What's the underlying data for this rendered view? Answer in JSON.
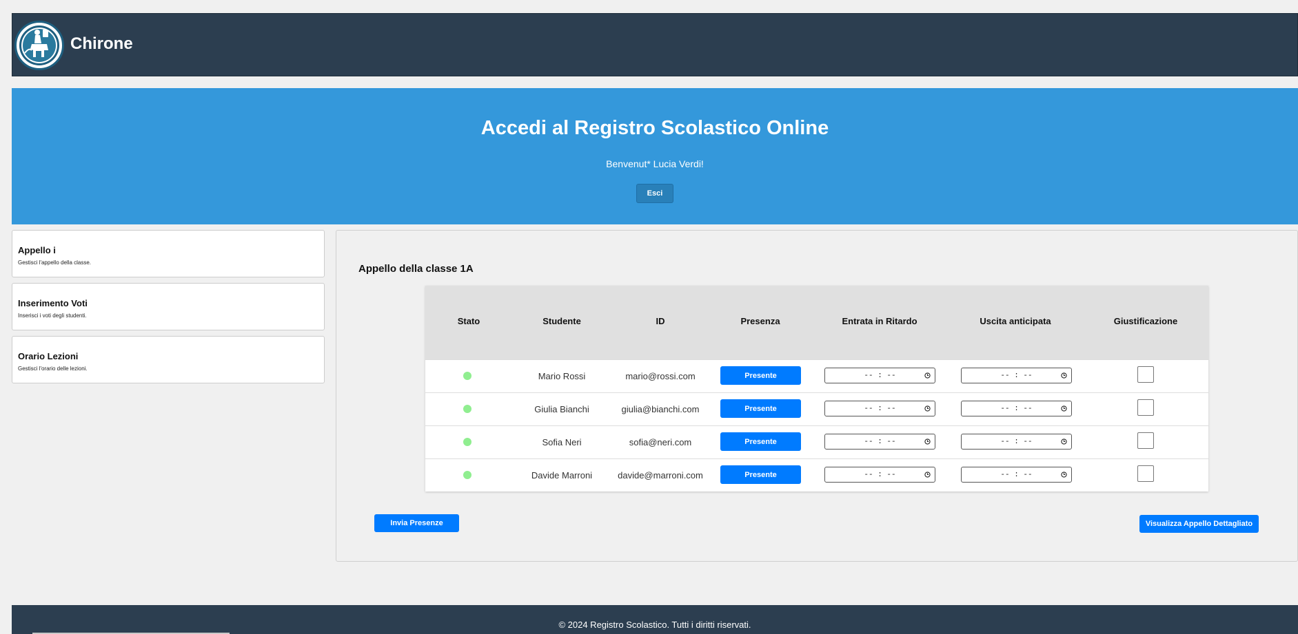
{
  "brand": {
    "name": "Chirone"
  },
  "hero": {
    "title": "Accedi al Registro Scolastico Online",
    "welcome": "Benvenut* Lucia Verdi!",
    "logout_label": "Esci"
  },
  "sidebar": {
    "cards": [
      {
        "title": "Appello i",
        "desc": "Gestisci l'appello della classe."
      },
      {
        "title": "Inserimento Voti",
        "desc": "Inserisci i voti degli studenti."
      },
      {
        "title": "Orario Lezioni",
        "desc": "Gestisci l'orario delle lezioni."
      }
    ]
  },
  "main": {
    "title": "Appello della classe 1A",
    "columns": [
      "Stato",
      "Studente",
      "ID",
      "Presenza",
      "Entrata in Ritardo",
      "Uscita anticipata",
      "Giustificazione"
    ],
    "rows": [
      {
        "status_color": "#90ee90",
        "student": "Mario Rossi",
        "id": "mario@rossi.com",
        "presence": "Presente",
        "late_entry": "-- : --",
        "early_exit": "-- : --",
        "justified": false
      },
      {
        "status_color": "#90ee90",
        "student": "Giulia Bianchi",
        "id": "giulia@bianchi.com",
        "presence": "Presente",
        "late_entry": "-- : --",
        "early_exit": "-- : --",
        "justified": false
      },
      {
        "status_color": "#90ee90",
        "student": "Sofia Neri",
        "id": "sofia@neri.com",
        "presence": "Presente",
        "late_entry": "-- : --",
        "early_exit": "-- : --",
        "justified": false
      },
      {
        "status_color": "#90ee90",
        "student": "Davide Marroni",
        "id": "davide@marroni.com",
        "presence": "Presente",
        "late_entry": "-- : --",
        "early_exit": "-- : --",
        "justified": false
      }
    ],
    "submit_label": "Invia Presenze",
    "detail_label": "Visualizza Appello Dettagliato"
  },
  "footer": {
    "text": "© 2024 Registro Scolastico. Tutti i diritti riservati."
  },
  "colors": {
    "header_bg": "#2c3e50",
    "hero_bg": "#3498db",
    "primary_button": "#007bff",
    "status_present": "#90ee90"
  },
  "icons": {
    "logo": "centaur-logo",
    "time": "clock-icon"
  }
}
